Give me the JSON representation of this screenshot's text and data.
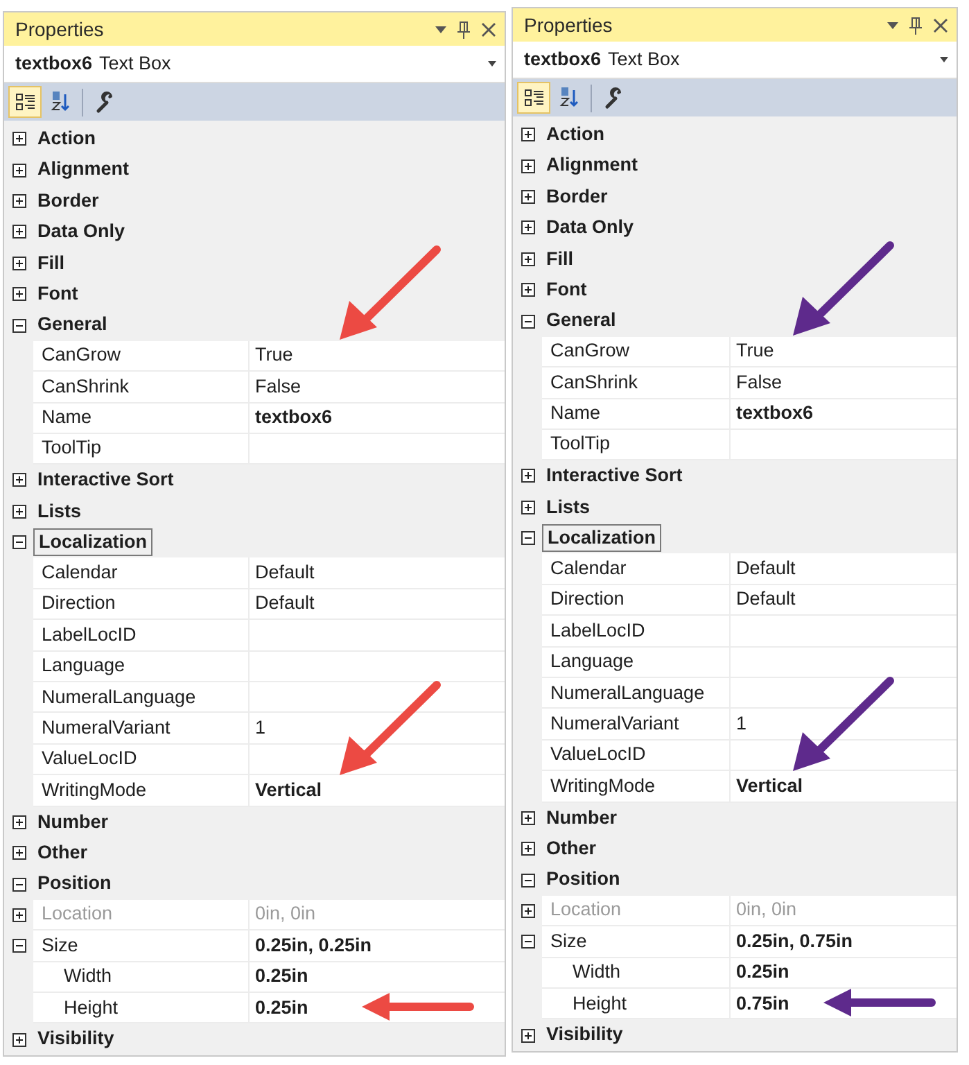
{
  "panels": [
    {
      "title": "Properties",
      "object_name": "textbox6",
      "object_type": "Text Box",
      "toolbar": [
        {
          "kind": "categorized",
          "selected": true
        },
        {
          "kind": "alphabetical",
          "selected": false
        },
        {
          "kind": "property-pages",
          "selected": false
        }
      ],
      "categories": [
        {
          "label": "Action",
          "expanded": false,
          "selected": false
        },
        {
          "label": "Alignment",
          "expanded": false,
          "selected": false
        },
        {
          "label": "Border",
          "expanded": false,
          "selected": false
        },
        {
          "label": "Data Only",
          "expanded": false,
          "selected": false
        },
        {
          "label": "Fill",
          "expanded": false,
          "selected": false
        },
        {
          "label": "Font",
          "expanded": false,
          "selected": false
        },
        {
          "label": "General",
          "expanded": true,
          "selected": false,
          "children": [
            {
              "name": "CanGrow",
              "value": "True",
              "bold": false,
              "disabled": false,
              "arrow": {
                "color": "#ec4a43",
                "kind": "diagonal"
              }
            },
            {
              "name": "CanShrink",
              "value": "False",
              "bold": false,
              "disabled": false
            },
            {
              "name": "Name",
              "value": "textbox6",
              "bold": true,
              "disabled": false
            },
            {
              "name": "ToolTip",
              "disabled": false
            }
          ]
        },
        {
          "label": "Interactive Sort",
          "expanded": false,
          "selected": false
        },
        {
          "label": "Lists",
          "expanded": false,
          "selected": false
        },
        {
          "label": "Localization",
          "expanded": true,
          "selected": true,
          "children": [
            {
              "name": "Calendar",
              "value": "Default",
              "bold": false,
              "disabled": false
            },
            {
              "name": "Direction",
              "value": "Default",
              "bold": false,
              "disabled": false
            },
            {
              "name": "LabelLocID",
              "disabled": false
            },
            {
              "name": "Language",
              "disabled": false
            },
            {
              "name": "NumeralLanguage",
              "disabled": false
            },
            {
              "name": "NumeralVariant",
              "value": "1",
              "bold": false,
              "disabled": false
            },
            {
              "name": "ValueLocID",
              "disabled": false
            },
            {
              "name": "WritingMode",
              "value": "Vertical",
              "bold": true,
              "disabled": false,
              "arrow": {
                "color": "#ec4a43",
                "kind": "diagonal"
              }
            }
          ]
        },
        {
          "label": "Number",
          "expanded": false,
          "selected": false
        },
        {
          "label": "Other",
          "expanded": false,
          "selected": false
        },
        {
          "label": "Position",
          "expanded": true,
          "selected": false,
          "children": [
            {
              "name": "Location",
              "value": "0in, 0in",
              "bold": false,
              "disabled": true,
              "expanded": false
            },
            {
              "name": "Size",
              "value": "0.25in, 0.25in",
              "bold": true,
              "disabled": false,
              "expanded": true,
              "children": [
                {
                  "name": "Width",
                  "value": "0.25in",
                  "bold": true,
                  "disabled": false
                },
                {
                  "name": "Height",
                  "value": "0.25in",
                  "bold": true,
                  "disabled": false,
                  "arrow": {
                    "color": "#ec4a43",
                    "kind": "horizontal"
                  }
                }
              ]
            }
          ]
        },
        {
          "label": "Visibility",
          "expanded": false,
          "selected": false
        }
      ]
    },
    {
      "title": "Properties",
      "object_name": "textbox6",
      "object_type": "Text Box",
      "toolbar": [
        {
          "kind": "categorized",
          "selected": true
        },
        {
          "kind": "alphabetical",
          "selected": false
        },
        {
          "kind": "property-pages",
          "selected": false
        }
      ],
      "categories": [
        {
          "label": "Action",
          "expanded": false,
          "selected": false
        },
        {
          "label": "Alignment",
          "expanded": false,
          "selected": false
        },
        {
          "label": "Border",
          "expanded": false,
          "selected": false
        },
        {
          "label": "Data Only",
          "expanded": false,
          "selected": false
        },
        {
          "label": "Fill",
          "expanded": false,
          "selected": false
        },
        {
          "label": "Font",
          "expanded": false,
          "selected": false
        },
        {
          "label": "General",
          "expanded": true,
          "selected": false,
          "children": [
            {
              "name": "CanGrow",
              "value": "True",
              "bold": false,
              "disabled": false,
              "arrow": {
                "color": "#5e2a8c",
                "kind": "diagonal"
              }
            },
            {
              "name": "CanShrink",
              "value": "False",
              "bold": false,
              "disabled": false
            },
            {
              "name": "Name",
              "value": "textbox6",
              "bold": true,
              "disabled": false
            },
            {
              "name": "ToolTip",
              "disabled": false
            }
          ]
        },
        {
          "label": "Interactive Sort",
          "expanded": false,
          "selected": false
        },
        {
          "label": "Lists",
          "expanded": false,
          "selected": false
        },
        {
          "label": "Localization",
          "expanded": true,
          "selected": true,
          "children": [
            {
              "name": "Calendar",
              "value": "Default",
              "bold": false,
              "disabled": false
            },
            {
              "name": "Direction",
              "value": "Default",
              "bold": false,
              "disabled": false
            },
            {
              "name": "LabelLocID",
              "disabled": false
            },
            {
              "name": "Language",
              "disabled": false
            },
            {
              "name": "NumeralLanguage",
              "disabled": false
            },
            {
              "name": "NumeralVariant",
              "value": "1",
              "bold": false,
              "disabled": false
            },
            {
              "name": "ValueLocID",
              "disabled": false
            },
            {
              "name": "WritingMode",
              "value": "Vertical",
              "bold": true,
              "disabled": false,
              "arrow": {
                "color": "#5e2a8c",
                "kind": "diagonal"
              }
            }
          ]
        },
        {
          "label": "Number",
          "expanded": false,
          "selected": false
        },
        {
          "label": "Other",
          "expanded": false,
          "selected": false
        },
        {
          "label": "Position",
          "expanded": true,
          "selected": false,
          "children": [
            {
              "name": "Location",
              "value": "0in, 0in",
              "bold": false,
              "disabled": true,
              "expanded": false
            },
            {
              "name": "Size",
              "value": "0.25in, 0.75in",
              "bold": true,
              "disabled": false,
              "expanded": true,
              "children": [
                {
                  "name": "Width",
                  "value": "0.25in",
                  "bold": true,
                  "disabled": false
                },
                {
                  "name": "Height",
                  "value": "0.75in",
                  "bold": true,
                  "disabled": false,
                  "arrow": {
                    "color": "#5e2a8c",
                    "kind": "horizontal"
                  }
                }
              ]
            }
          ]
        },
        {
          "label": "Visibility",
          "expanded": false,
          "selected": false
        }
      ]
    }
  ]
}
